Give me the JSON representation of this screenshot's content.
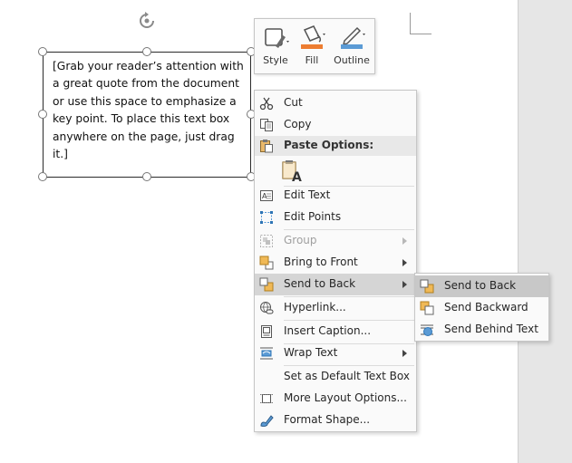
{
  "textbox": {
    "text": "[Grab your reader’s attention with a great quote from the document or use this space to emphasize a key point. To place this text box anywhere on the page, just drag it.]"
  },
  "mini_toolbar": {
    "style_label": "Style",
    "fill_label": "Fill",
    "outline_label": "Outline",
    "fill_color": "#ed7d31",
    "outline_color": "#5b9bd5"
  },
  "context_menu": {
    "cut": "Cut",
    "copy": "Copy",
    "paste_options": "Paste Options:",
    "edit_text": "Edit Text",
    "edit_points": "Edit Points",
    "group": "Group",
    "bring_to_front": "Bring to Front",
    "send_to_back": "Send to Back",
    "hyperlink": "Hyperlink...",
    "insert_caption": "Insert Caption...",
    "wrap_text": "Wrap Text",
    "set_default": "Set as Default Text Box",
    "more_layout": "More Layout Options...",
    "format_shape": "Format Shape..."
  },
  "submenu": {
    "send_to_back": "Send to Back",
    "send_backward": "Send Backward",
    "send_behind_text": "Send Behind Text"
  },
  "colors": {
    "accent_orange": "#ed7d31",
    "accent_blue": "#5b9bd5",
    "hover_gray": "#d5d5d5"
  }
}
